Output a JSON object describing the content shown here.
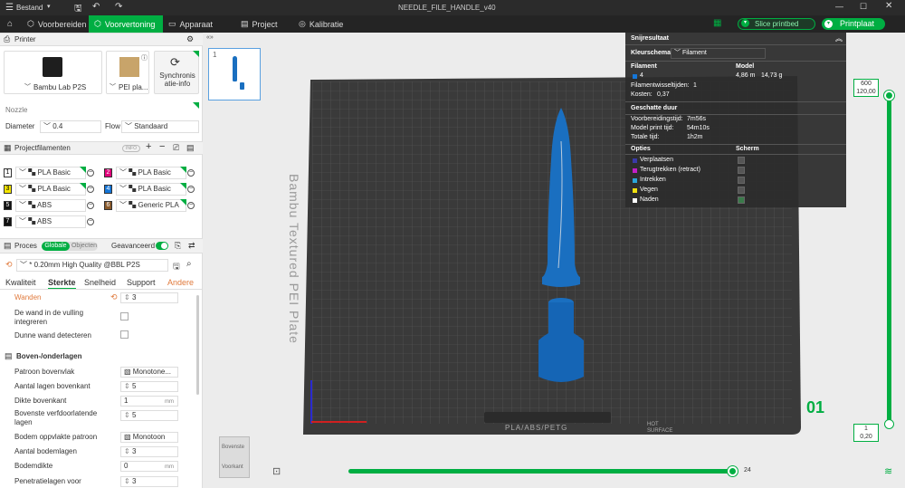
{
  "topbar": {
    "menu_label": "Bestand",
    "file_title": "NEEDLE_FILE_HANDLE_v40"
  },
  "tabs": {
    "prepare": "Voorbereiden",
    "preview": "Voorvertoning",
    "device": "Apparaat",
    "project": "Project",
    "calibration": "Kalibratie"
  },
  "actions": {
    "slice": "Slice printbed",
    "print": "Printplaat"
  },
  "printer": {
    "section_title": "Printer",
    "name": "Bambu Lab P2S",
    "plate": "PEI pla...",
    "sync_label": "Synchronisatie-info",
    "nozzle_label": "Nozzle",
    "diameter_label": "Diameter",
    "diameter_value": "0.4",
    "flow_label": "Flow",
    "flow_value": "Standaard"
  },
  "filaments": {
    "section_title": "Projectfilamenten",
    "items": [
      {
        "num": "1",
        "name": "PLA Basic",
        "color": "#ffffff"
      },
      {
        "num": "2",
        "name": "PLA Basic",
        "color": "#e0007a"
      },
      {
        "num": "3",
        "name": "PLA Basic",
        "color": "#f6e600"
      },
      {
        "num": "4",
        "name": "PLA Basic",
        "color": "#1576d8"
      },
      {
        "num": "5",
        "name": "ABS",
        "color": "#111111"
      },
      {
        "num": "6",
        "name": "Generic PLA",
        "color": "#8a5a2b"
      },
      {
        "num": "7",
        "name": "ABS",
        "color": "#111111"
      }
    ]
  },
  "process": {
    "section_title": "Proces",
    "toggle_global": "Globale",
    "toggle_objects": "Objecten",
    "advanced_label": "Geavanceerd",
    "preset": "* 0.20mm High Quality @BBL P2S",
    "tabs": [
      "Kwaliteit",
      "Sterkte",
      "Snelheid",
      "Support",
      "Andere"
    ],
    "walls_label": "Wanden",
    "walls_value": "3",
    "infill_wall_label": "De wand in de vulling integreren",
    "thin_wall_label": "Dunne wand detecteren",
    "top_bottom_title": "Boven-/onderlagen",
    "rows": [
      {
        "label": "Patroon bovenvlak",
        "value": "Monotone..."
      },
      {
        "label": "Aantal lagen bovenkant",
        "value": "5"
      },
      {
        "label": "Dikte bovenkant",
        "value": "1",
        "unit": "mm"
      },
      {
        "label": "Bovenste verfdoorlatende lagen",
        "value": "5"
      },
      {
        "label": "Bodem oppvlakte patroon",
        "value": "Monotoon"
      },
      {
        "label": "Aantal bodemlagen",
        "value": "3"
      },
      {
        "label": "Bodemdikte",
        "value": "0",
        "unit": "mm"
      },
      {
        "label": "Penetratielagen voor",
        "value": "3"
      }
    ]
  },
  "plate": {
    "thumb_number": "1",
    "plate_text": "Bambu Textured PEI Plate",
    "bottom_label": "PLA/ABS/PETG",
    "surface_label": "HOT SURFACE",
    "plate_number": "01"
  },
  "slice_result": {
    "title": "Snijresultaat",
    "color_scheme_label": "Kleurschema",
    "color_scheme_value": "Filament",
    "col_filament": "Filament",
    "col_model": "Model",
    "filament_num": "4",
    "filament_length": "4,86 m",
    "filament_weight": "14,73 g",
    "changes_label": "Filamentwisseltijden:",
    "changes_value": "1",
    "cost_label": "Kosten:",
    "cost_value": "0,37",
    "duration_title": "Geschatte duur",
    "prep_label": "Voorbereidingstijd:",
    "prep_value": "7m56s",
    "model_time_label": "Model print tijd:",
    "model_time_value": "54m10s",
    "total_label": "Totale tijd:",
    "total_value": "1h2m",
    "options_label": "Opties",
    "screen_label": "Scherm",
    "options": [
      {
        "name": "Verplaatsen",
        "color": "#3a3aa8"
      },
      {
        "name": "Terugtrekken (retract)",
        "color": "#c21fc7"
      },
      {
        "name": "Intrekken",
        "color": "#2aa6d8"
      },
      {
        "name": "Vegen",
        "color": "#f0e010"
      },
      {
        "name": "Naden",
        "color": "#ffffff"
      }
    ]
  },
  "layer_slider": {
    "top_value": "600",
    "top_height": "120,00",
    "bottom_value": "1",
    "bottom_height": "0,20"
  },
  "move_slider": {
    "value": "24"
  },
  "view_cube": {
    "top": "Bovenste",
    "front": "Voorkant"
  }
}
